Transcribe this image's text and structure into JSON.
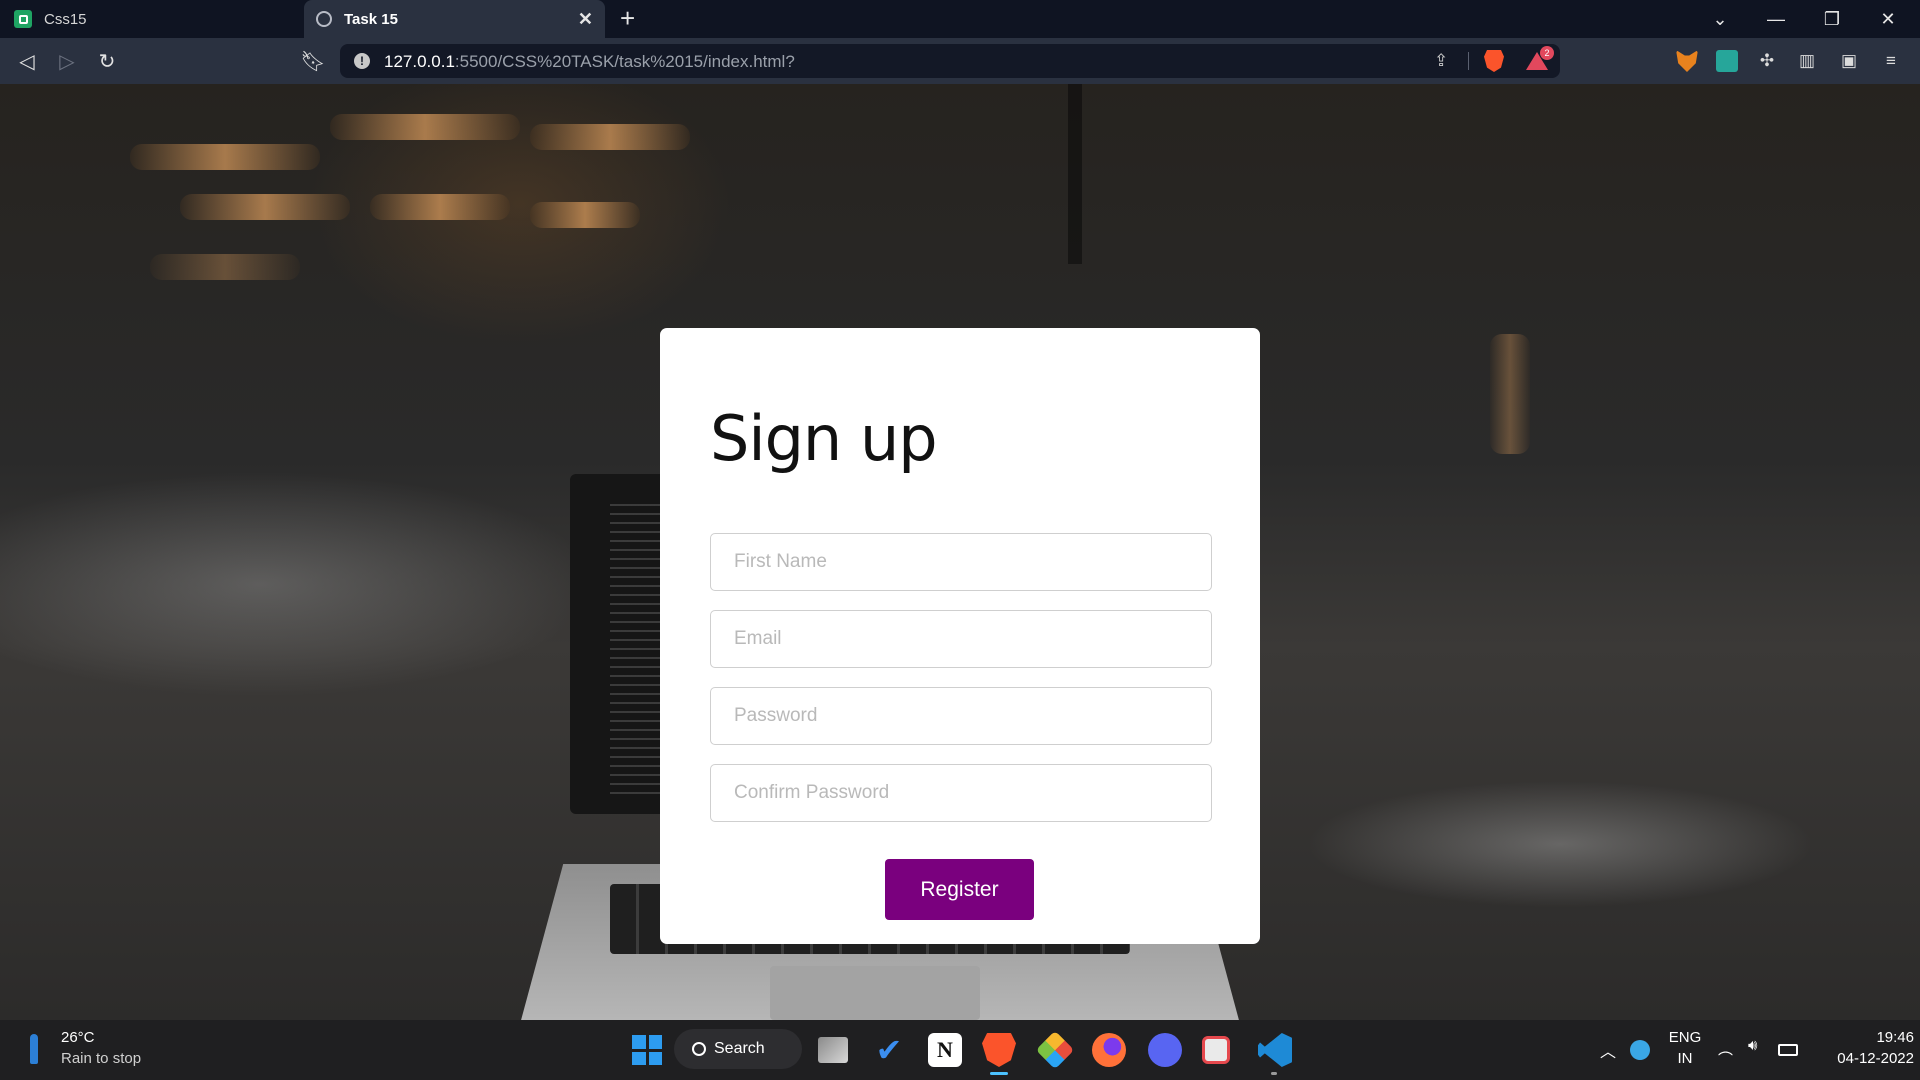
{
  "browser": {
    "tabs": [
      {
        "title": "Css15",
        "active": false,
        "icon": "sheets-icon"
      },
      {
        "title": "Task 15",
        "active": true,
        "icon": "globe-icon"
      }
    ],
    "url_host": "127.0.0.1",
    "url_rest": ":5500/CSS%20TASK/task%2015/index.html?",
    "rewards_badge": "2"
  },
  "form": {
    "title": "Sign up",
    "first_name_placeholder": "First Name",
    "email_placeholder": "Email",
    "password_placeholder": "Password",
    "confirm_password_placeholder": "Confirm Password",
    "register_label": "Register",
    "accent_color": "#7a007e"
  },
  "taskbar": {
    "weather_temp": "26°C",
    "weather_desc": "Rain to stop",
    "search_label": "Search",
    "language_top": "ENG",
    "language_bottom": "IN",
    "time": "19:46",
    "date": "04-12-2022",
    "apps": [
      "start-icon",
      "task-view-icon",
      "todo-icon",
      "notion-icon",
      "brave-icon",
      "git-icon",
      "firefox-icon",
      "discord-icon",
      "snipping-tool-icon",
      "vscode-icon"
    ]
  }
}
